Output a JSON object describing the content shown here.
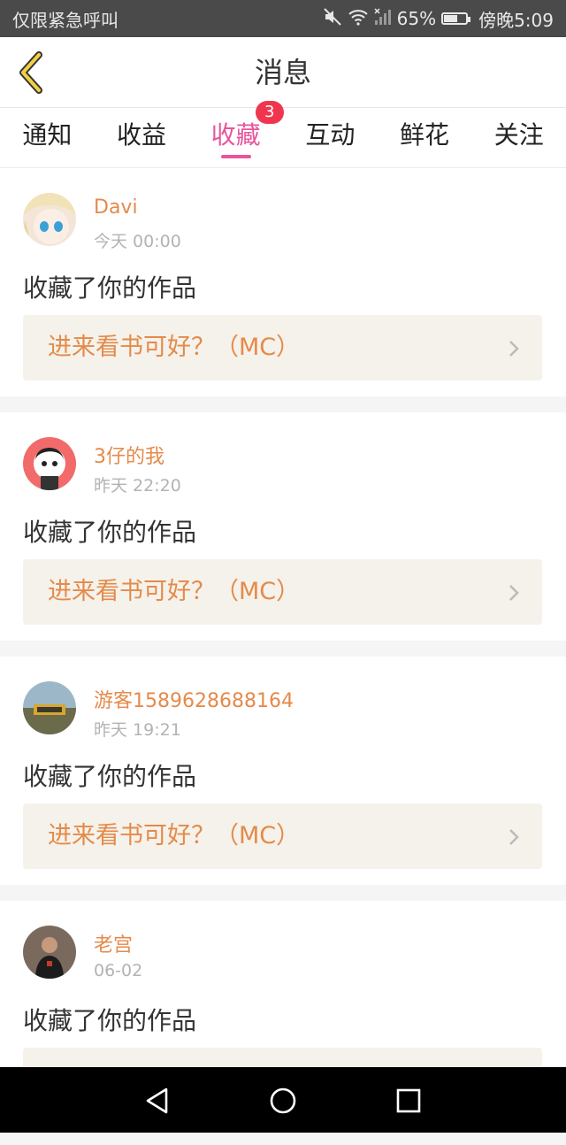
{
  "status_bar": {
    "carrier": "仅限紧急呼叫",
    "battery_text": "65%",
    "battery_level": 0.65,
    "time": "傍晚5:09",
    "icons": [
      "mute-icon",
      "wifi-icon",
      "signal-icon",
      "battery-icon"
    ]
  },
  "header": {
    "title": "消息",
    "back_icon": "chevron-left-icon",
    "accent_color": "#f1d042"
  },
  "tabs": [
    {
      "label": "通知"
    },
    {
      "label": "收益"
    },
    {
      "label": "收藏",
      "badge": "3",
      "active": true
    },
    {
      "label": "互动"
    },
    {
      "label": "鲜花"
    },
    {
      "label": "关注"
    }
  ],
  "colors": {
    "active_tab": "#e8559c",
    "badge": "#f0364e",
    "username": "#e58a4a",
    "link_bg": "#f4f2ea"
  },
  "messages": [
    {
      "username": "Davi",
      "time": "今天 00:00",
      "action": "收藏了你的作品",
      "work_title": "进来看书可好？（MC）",
      "avatar": "anime-girl-avatar"
    },
    {
      "username": "3仔的我",
      "time": "昨天 22:20",
      "action": "收藏了你的作品",
      "work_title": "进来看书可好？（MC）",
      "avatar": "cartoon-avatar"
    },
    {
      "username": "游客1589628688164",
      "time": "昨天 19:21",
      "action": "收藏了你的作品",
      "work_title": "进来看书可好？（MC）",
      "avatar": "game-avatar"
    },
    {
      "username": "老宫",
      "time": "06-02",
      "action": "收藏了你的作品",
      "work_title": "",
      "avatar": "photo-avatar"
    }
  ],
  "nav_bar": {
    "icons": [
      "back-triangle-icon",
      "home-circle-icon",
      "recents-square-icon"
    ]
  }
}
